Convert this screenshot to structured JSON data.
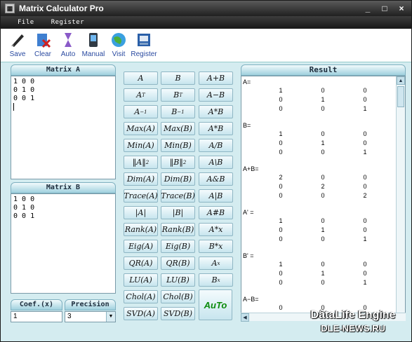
{
  "window": {
    "title": "Matrix Calculator Pro",
    "minimize": "_",
    "maximize": "□",
    "close": "×"
  },
  "menu": [
    "File",
    "Register"
  ],
  "toolbar": [
    {
      "label": "Save",
      "icon": "save-icon"
    },
    {
      "label": "Clear",
      "icon": "clear-icon"
    },
    {
      "label": "Auto",
      "icon": "auto-icon"
    },
    {
      "label": "Manual",
      "icon": "manual-icon"
    },
    {
      "label": "Visit",
      "icon": "globe-icon"
    },
    {
      "label": "Register",
      "icon": "register-icon"
    }
  ],
  "matrixA": {
    "title": "Matrix A",
    "value": "1 0 0\n0 1 0\n0 0 1\n"
  },
  "matrixB": {
    "title": "Matrix B",
    "value": "1 0 0\n0 1 0\n0 0 1"
  },
  "coef": {
    "title": "Coef.(x)",
    "value": "1"
  },
  "precision": {
    "title": "Precision",
    "value": "3"
  },
  "ops": {
    "A": "A",
    "B": "B",
    "ApB": "A+B",
    "AT": "A",
    "BT": "B",
    "AmB": "A−B",
    "Ainv": "A",
    "Binv": "B",
    "AxB": "A*B",
    "MaxA": "Max(A)",
    "MaxB": "Max(B)",
    "AxB2": "A*B",
    "MinA": "Min(A)",
    "MinB": "Min(B)",
    "AdB": "A/B",
    "NormA": "A",
    "NormB": "B",
    "AbB": "A\\B",
    "DimA": "Dim(A)",
    "DimB": "Dim(B)",
    "AandB": "A&B",
    "TraceA": "Trace(A)",
    "TraceB": "Trace(B)",
    "AorB": "A|B",
    "DetA": "A",
    "DetB": "B",
    "AhB": "A#B",
    "RankA": "Rank(A)",
    "RankB": "Rank(B)",
    "Amx": "A*x",
    "EigA": "Eig(A)",
    "EigB": "Eig(B)",
    "Bmx": "B*x",
    "QRA": "QR(A)",
    "QRB": "QR(B)",
    "Apx": "A",
    "LUA": "LU(A)",
    "LUB": "LU(B)",
    "Bpx": "B",
    "CholA": "Chol(A)",
    "CholB": "Chol(B)",
    "SVDA": "SVD(A)",
    "SVDB": "SVD(B)",
    "auto": "AuTo",
    "sup_T": "T",
    "sup_inv": "−1",
    "sub_2": "2",
    "sup_x": "x"
  },
  "result": {
    "title": "Result",
    "blocks": [
      {
        "label": "A=",
        "rows": [
          [
            "1",
            "0",
            "0"
          ],
          [
            "0",
            "1",
            "0"
          ],
          [
            "0",
            "0",
            "1"
          ]
        ]
      },
      {
        "label": "B=",
        "rows": [
          [
            "1",
            "0",
            "0"
          ],
          [
            "0",
            "1",
            "0"
          ],
          [
            "0",
            "0",
            "1"
          ]
        ]
      },
      {
        "label": "A+B=",
        "rows": [
          [
            "2",
            "0",
            "0"
          ],
          [
            "0",
            "2",
            "0"
          ],
          [
            "0",
            "0",
            "2"
          ]
        ]
      },
      {
        "label": "A' =",
        "rows": [
          [
            "1",
            "0",
            "0"
          ],
          [
            "0",
            "1",
            "0"
          ],
          [
            "0",
            "0",
            "1"
          ]
        ]
      },
      {
        "label": "B' =",
        "rows": [
          [
            "1",
            "0",
            "0"
          ],
          [
            "0",
            "1",
            "0"
          ],
          [
            "0",
            "0",
            "1"
          ]
        ]
      },
      {
        "label": "A−B=",
        "rows": [
          [
            "0",
            "0",
            "0"
          ]
        ]
      }
    ]
  },
  "watermark": {
    "line1": "DâtaLife Engine",
    "line2": "DLE-NEWS.RU"
  }
}
